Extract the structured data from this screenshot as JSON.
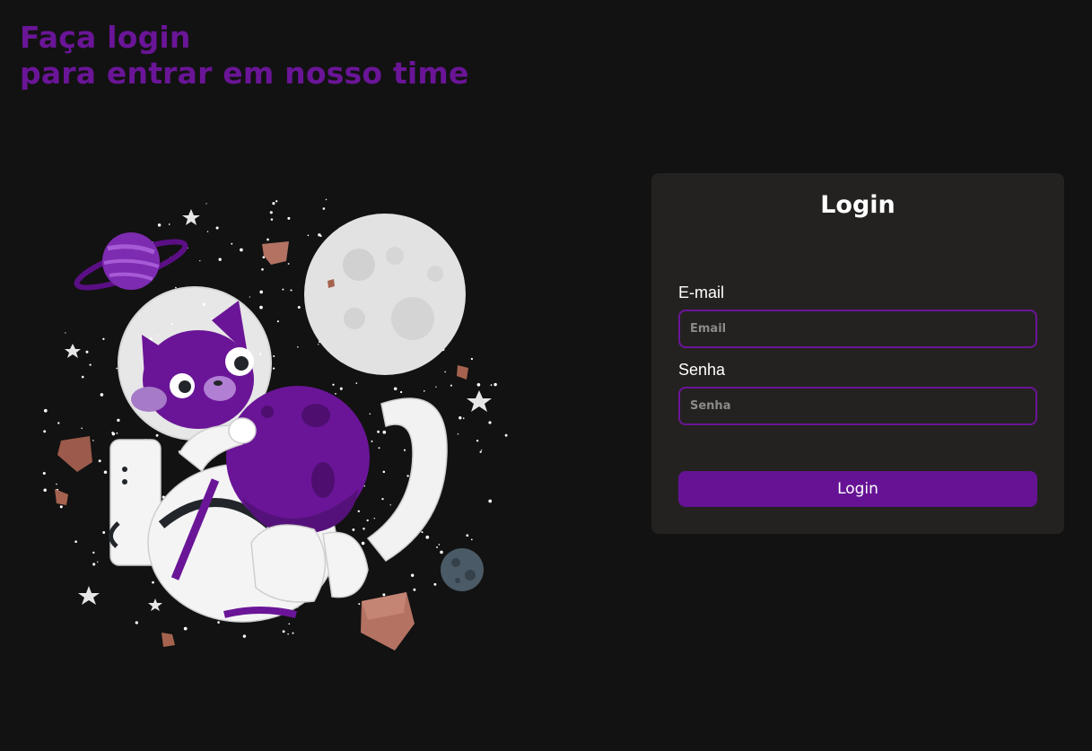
{
  "hero": {
    "line1": "Faça login",
    "line2": "para entrar em nosso time"
  },
  "illustration": {
    "subject": "astronaut-cat-in-space",
    "colors": {
      "accent": "#6a1597",
      "background": "#121212",
      "moon": "#e0e0e0",
      "rock": "#b47262"
    }
  },
  "login_card": {
    "title": "Login",
    "email": {
      "label": "E-mail",
      "placeholder": "Email",
      "value": ""
    },
    "password": {
      "label": "Senha",
      "placeholder": "Senha",
      "value": ""
    },
    "submit_label": "Login"
  },
  "theme": {
    "accent": "#6a1597",
    "button": "#651394",
    "card": "#242220",
    "page": "#121212"
  }
}
